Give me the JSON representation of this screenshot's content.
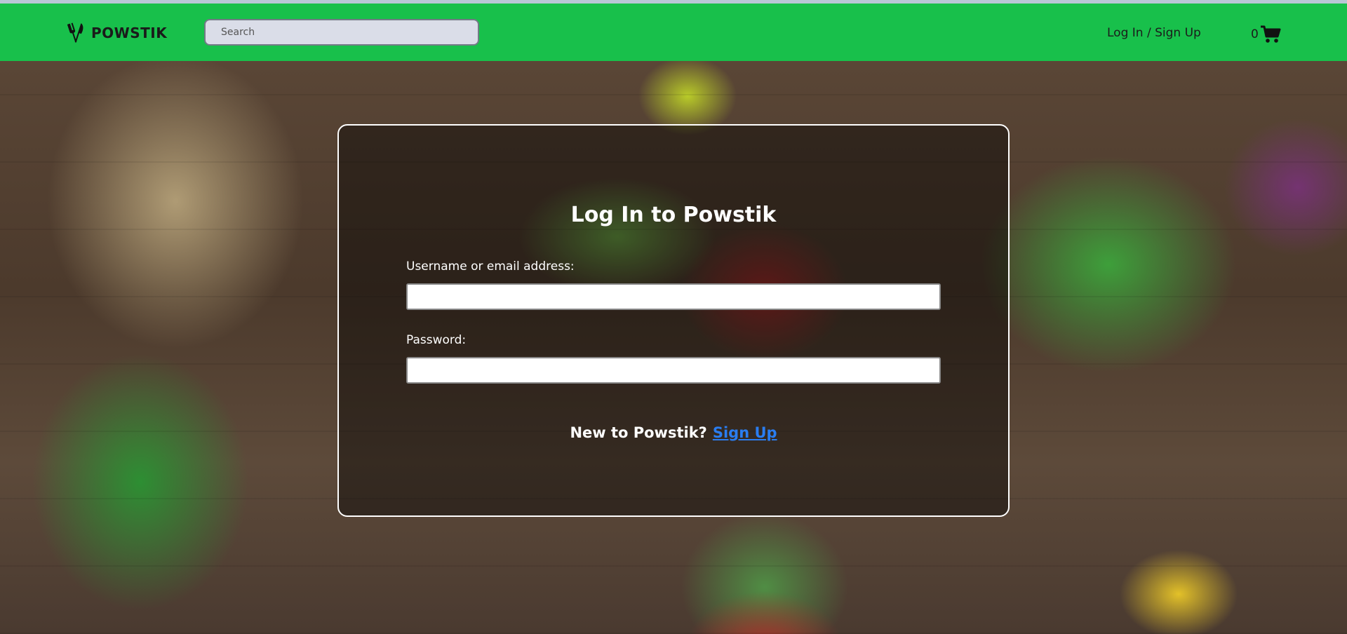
{
  "header": {
    "brand_name": "POWSTIK",
    "search_placeholder": "Search",
    "login_link": "Log In / Sign Up",
    "cart_count": "0"
  },
  "login": {
    "title": "Log In to Powstik",
    "username_label": "Username or email address:",
    "username_value": "",
    "password_label": "Password:",
    "password_value": "",
    "signup_prompt": "New to Powstik?",
    "signup_link": "Sign Up"
  },
  "colors": {
    "navbar": "#18c04b",
    "link": "#2a7df0"
  }
}
